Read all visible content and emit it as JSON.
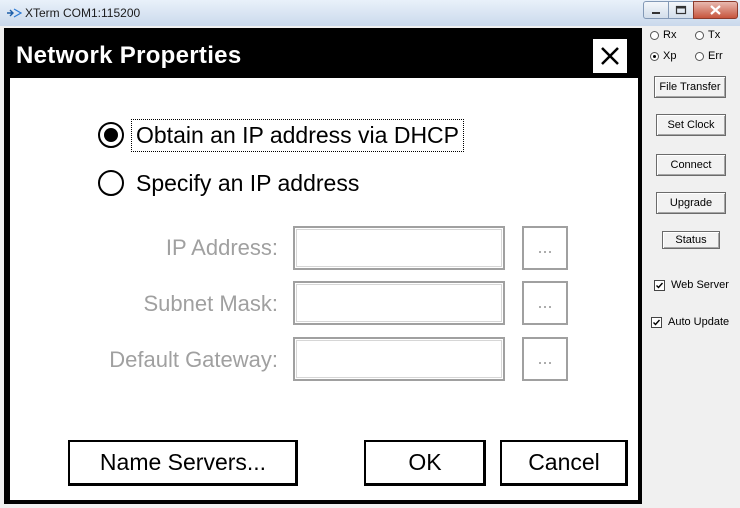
{
  "window": {
    "title": "XTerm COM1:115200",
    "icon": "serial-terminal-icon"
  },
  "dialog": {
    "title": "Network Properties",
    "close_icon": "close-icon",
    "options": [
      {
        "label": "Obtain an IP address via DHCP",
        "selected": true
      },
      {
        "label": "Specify an IP address",
        "selected": false
      }
    ],
    "fields": [
      {
        "label": "IP Address:",
        "value": "",
        "button": "..."
      },
      {
        "label": "Subnet Mask:",
        "value": "",
        "button": "..."
      },
      {
        "label": "Default Gateway:",
        "value": "",
        "button": "..."
      }
    ],
    "buttons": {
      "name_servers": "Name Servers...",
      "ok": "OK",
      "cancel": "Cancel"
    }
  },
  "side": {
    "radios": [
      {
        "label": "Rx",
        "selected": false
      },
      {
        "label": "Tx",
        "selected": false
      },
      {
        "label": "Xp",
        "selected": true
      },
      {
        "label": "Err",
        "selected": false
      }
    ],
    "buttons": [
      "File Transfer",
      "Set Clock",
      "Connect",
      "Upgrade",
      "Status"
    ],
    "checks": [
      {
        "label": "Web Server",
        "checked": true
      },
      {
        "label": "Auto Update",
        "checked": true
      }
    ]
  }
}
